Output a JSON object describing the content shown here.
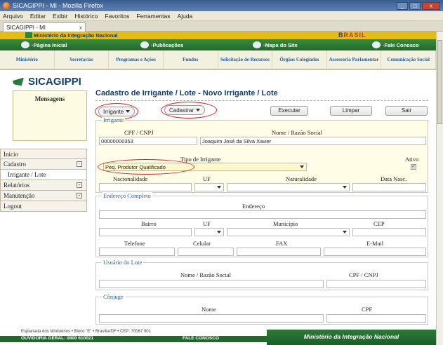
{
  "window": {
    "title": "SICAGIPPI - MI - Mozilla Firefox"
  },
  "menubar": [
    "Arquivo",
    "Editar",
    "Exibir",
    "Histórico",
    "Favoritos",
    "Ferramentas",
    "Ajuda"
  ],
  "tab": {
    "label": "SICAGIPPI - MI",
    "close": "x"
  },
  "gov": {
    "text": "Ministério da Integração Nacional",
    "brand_a": "B",
    "brand_b": "RASIL"
  },
  "topnav": {
    "home": "·Página Inicial",
    "pubs": "·Publicações",
    "map": "·Mapa do Site",
    "contact": "·Fale Conosco"
  },
  "secnav": [
    "Ministério",
    "Secretarias",
    "Programas e Ações",
    "Fundos",
    "Solicitação de Recursos",
    "Órgãos Colegiados",
    "Assessoria Parlamentar",
    "Comunicação Social"
  ],
  "logo": "SICAGIPPI",
  "messages": {
    "title": "Mensagens"
  },
  "side_menu": [
    {
      "label": "Início"
    },
    {
      "label": "Cadastro",
      "exp": "−"
    },
    {
      "label": "Irrigante / Lote"
    },
    {
      "label": "Relatórios",
      "exp": "+"
    },
    {
      "label": "Manutenção",
      "exp": "+"
    },
    {
      "label": "Logout"
    }
  ],
  "main": {
    "title": "Cadastro de Irrigante / Lote - Novo Irrigante / Lote",
    "irrigante_menu": "Irrigante",
    "cadastrar_menu": "Cadastrar",
    "executar": "Executar",
    "limpar": "Limpar",
    "sair": "Sair"
  },
  "irrigante": {
    "legend": "Irrigante",
    "cpf_label": "CPF / CNPJ",
    "cpf_value": "00000000353",
    "nome_label": "Nome / Razão Social",
    "nome_value": "Joaquim José da Silva Xavier",
    "tipo_label": "Tipo de Irrigante",
    "tipo_value": "Peq. Produtor Qualificado",
    "ativo_label": "Ativo",
    "ativo_check": "✓",
    "nacionalidade_label": "Nacionalidade",
    "uf_label": "UF",
    "naturalidade_label": "Naturalidade",
    "data_nasc_label": "Data Nasc."
  },
  "endereco": {
    "legend": "Endereço Completo",
    "endereco_label": "Endereço",
    "bairro_label": "Bairro",
    "uf_label": "UF",
    "municipio_label": "Município",
    "cep_label": "CEP",
    "telefone_label": "Telefone",
    "celular_label": "Celular",
    "fax_label": "FAX",
    "email_label": "E-Mail"
  },
  "usuario": {
    "legend": "Usuário do Lote",
    "nome_label": "Nome / Razão Social",
    "cpf_label": "CPF / CNPJ"
  },
  "conjuge": {
    "legend": "Cônjuge",
    "nome_label": "Nome",
    "cpf_label": "CPF"
  },
  "footer": {
    "address": "Esplanada dos Ministérios • Bloco \"E\" • Brasília/DF • CEP: 70067 901",
    "ouvidoria": "OUVIDORIA GERAL: 0800 610021",
    "fale": "FALE CONOSCO",
    "ministerio": "Ministério da Integração Nacional"
  }
}
